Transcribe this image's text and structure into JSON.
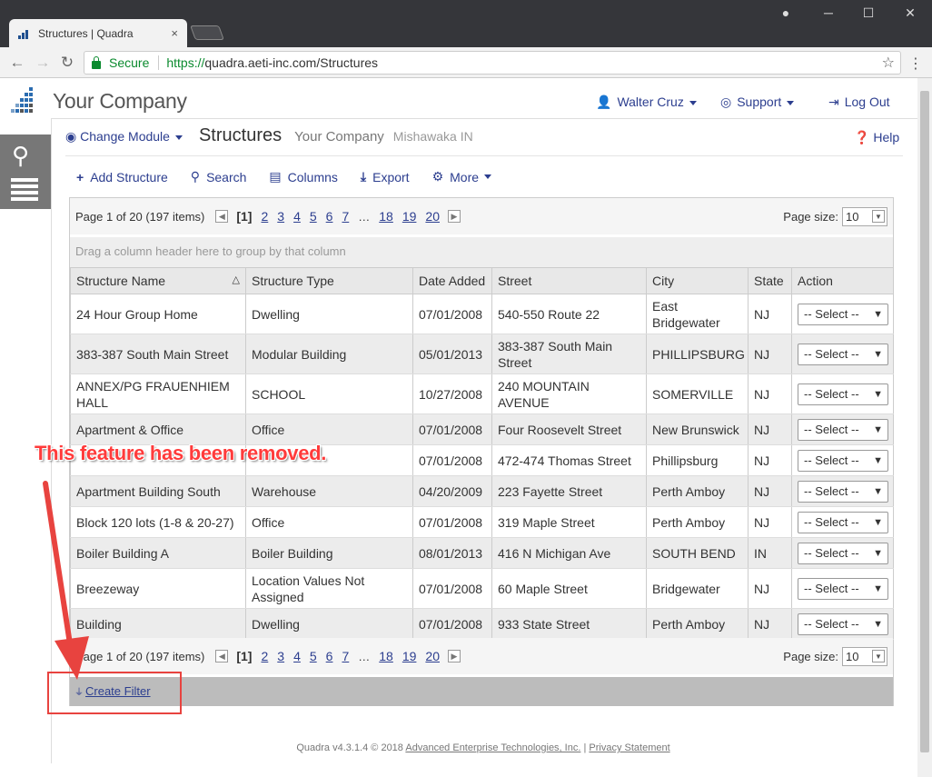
{
  "browser": {
    "tab_title": "Structures | Quadra",
    "tab_close": "×",
    "secure_label": "Secure",
    "url_prefix": "https://",
    "url_rest": "quadra.aeti-inc.com/Structures",
    "icons": [
      "back-icon",
      "forward-icon",
      "reload-icon",
      "star-icon",
      "menu-icon",
      "account-icon"
    ]
  },
  "header": {
    "company": "Your Company",
    "user": "Walter Cruz",
    "support": "Support",
    "logout": "Log Out"
  },
  "page": {
    "change_module": "Change Module",
    "title": "Structures",
    "company": "Your Company",
    "location": "Mishawaka IN",
    "help": "Help"
  },
  "toolbar": {
    "add": "Add Structure",
    "search": "Search",
    "columns": "Columns",
    "export": "Export",
    "more": "More"
  },
  "pager": {
    "info": "Page 1 of 20 (197 items)",
    "current": "[1]",
    "pages": [
      "2",
      "3",
      "4",
      "5",
      "6",
      "7"
    ],
    "dots": "…",
    "tail": [
      "18",
      "19",
      "20"
    ],
    "size_label": "Page size:",
    "size_value": "10"
  },
  "grid": {
    "group_hint": "Drag a column header here to group by that column",
    "columns": [
      "Structure Name",
      "Structure Type",
      "Date Added",
      "Street",
      "City",
      "State",
      "Action"
    ],
    "select_label": "-- Select --",
    "rows": [
      [
        "24 Hour Group Home",
        "Dwelling",
        "07/01/2008",
        "540-550 Route 22",
        "East Bridgewater",
        "NJ"
      ],
      [
        "383-387 South Main Street",
        "Modular Building",
        "05/01/2013",
        "383-387 South Main Street",
        "PHILLIPSBURG",
        "NJ"
      ],
      [
        "ANNEX/PG FRAUENHIEM HALL",
        "SCHOOL",
        "10/27/2008",
        "240 MOUNTAIN AVENUE",
        "SOMERVILLE",
        "NJ"
      ],
      [
        "Apartment & Office",
        "Office",
        "07/01/2008",
        "Four Roosevelt Street",
        "New Brunswick",
        "NJ"
      ],
      [
        "",
        "",
        "07/01/2008",
        "472-474 Thomas Street",
        "Phillipsburg",
        "NJ"
      ],
      [
        "Apartment Building South",
        "Warehouse",
        "04/20/2009",
        "223 Fayette Street",
        "Perth Amboy",
        "NJ"
      ],
      [
        "Block 120 lots (1-8 & 20-27)",
        "Office",
        "07/01/2008",
        "319 Maple Street",
        "Perth Amboy",
        "NJ"
      ],
      [
        "Boiler Building A",
        "Boiler Building",
        "08/01/2013",
        "416 N Michigan Ave",
        "SOUTH BEND",
        "IN"
      ],
      [
        "Breezeway",
        "Location Values Not Assigned",
        "07/01/2008",
        "60 Maple Street",
        "Bridgewater",
        "NJ"
      ],
      [
        "Building",
        "Dwelling",
        "07/01/2008",
        "933 State Street",
        "Perth Amboy",
        "NJ"
      ]
    ],
    "create_filter": "Create Filter"
  },
  "footer": {
    "version": "Quadra v4.3.1.4 © 2018",
    "company_link": "Advanced Enterprise Technologies, Inc.",
    "sep": "|",
    "privacy": "Privacy Statement"
  },
  "annotation": {
    "text": "This feature has been removed.",
    "color": "#e8433f"
  }
}
